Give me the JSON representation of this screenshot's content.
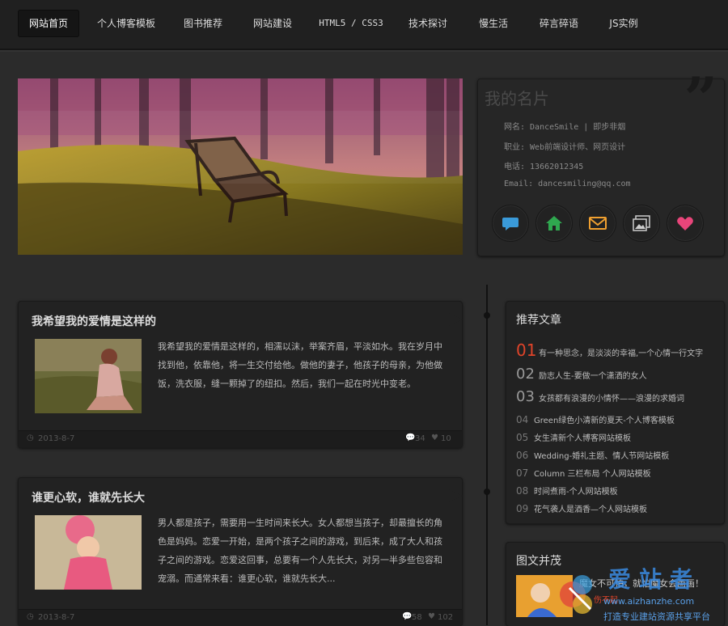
{
  "nav": {
    "items": [
      {
        "label": "网站首页",
        "active": true
      },
      {
        "label": "个人博客模板",
        "active": false
      },
      {
        "label": "图书推荐",
        "active": false
      },
      {
        "label": "网站建设",
        "active": false
      },
      {
        "label": "HTML5 / CSS3",
        "active": false
      },
      {
        "label": "技术探讨",
        "active": false
      },
      {
        "label": "慢生活",
        "active": false
      },
      {
        "label": "碎言碎语",
        "active": false
      },
      {
        "label": "JS实例",
        "active": false
      }
    ]
  },
  "card": {
    "title": "我的名片",
    "lines": [
      "网名: DanceSmile | 即步非烟",
      "职业: Web前端设计师、网页设计",
      "电话: 13662012345",
      "Email: dancesmiling@qq.com"
    ],
    "icons": [
      "chat-icon",
      "home-icon",
      "mail-icon",
      "gallery-icon",
      "heart-icon"
    ],
    "colors": {
      "chat": "#3a9ad9",
      "home": "#2fa84f",
      "mail": "#f0a030",
      "gallery": "#cccccc",
      "heart": "#e8457a"
    }
  },
  "articles": [
    {
      "title": "我希望我的爱情是这样的",
      "text": "我希望我的爱情是这样的，相濡以沫，举案齐眉，平淡如水。我在岁月中找到他，依靠他，将一生交付给他。做他的妻子，他孩子的母亲，为他做饭，洗衣服，缝一颗掉了的纽扣。然后，我们一起在时光中变老。",
      "date": "2013-8-7",
      "comments": "34",
      "likes": "10"
    },
    {
      "title": "谁更心软，谁就先长大",
      "text": "男人都是孩子，需要用一生时间来长大。女人都想当孩子，却最擅长的角色是妈妈。恋爱一开始，是两个孩子之间的游戏，到后来，成了大人和孩子之间的游戏。恋爱这回事，总要有一个人先长大，对另一半多些包容和宠溺。而通常来看：谁更心软，谁就先长大...",
      "date": "2013-8-7",
      "comments": "58",
      "likes": "102"
    }
  ],
  "recommend": {
    "title": "推荐文章",
    "items": [
      {
        "num": "01",
        "text": "有一种思念，是淡淡的幸福,一个心情一行文字"
      },
      {
        "num": "02",
        "text": "励志人生-要做一个潇洒的女人"
      },
      {
        "num": "03",
        "text": "女孩都有浪漫的小情怀——浪漫的求婚词"
      },
      {
        "num": "04",
        "text": "Green绿色小清新的夏天-个人博客模板"
      },
      {
        "num": "05",
        "text": "女生清新个人博客网站模板"
      },
      {
        "num": "06",
        "text": "Wedding-婚礼主题、情人节网站模板"
      },
      {
        "num": "07",
        "text": "Column 三栏布局 个人网站模板"
      },
      {
        "num": "08",
        "text": "时间煮雨-个人网站模板"
      },
      {
        "num": "09",
        "text": "花气袭人是酒香—个人网站模板"
      }
    ],
    "highlight_color": "#e0442a"
  },
  "pictext": {
    "title": "图文并茂",
    "item_title": "魔女不可怕，就怕魔女会画画！",
    "item_sub": "伤不起"
  },
  "watermark": {
    "brand": "爱站者",
    "url": "www.aizhanzhe.com",
    "slogan": "打造专业建站资源共享平台"
  }
}
